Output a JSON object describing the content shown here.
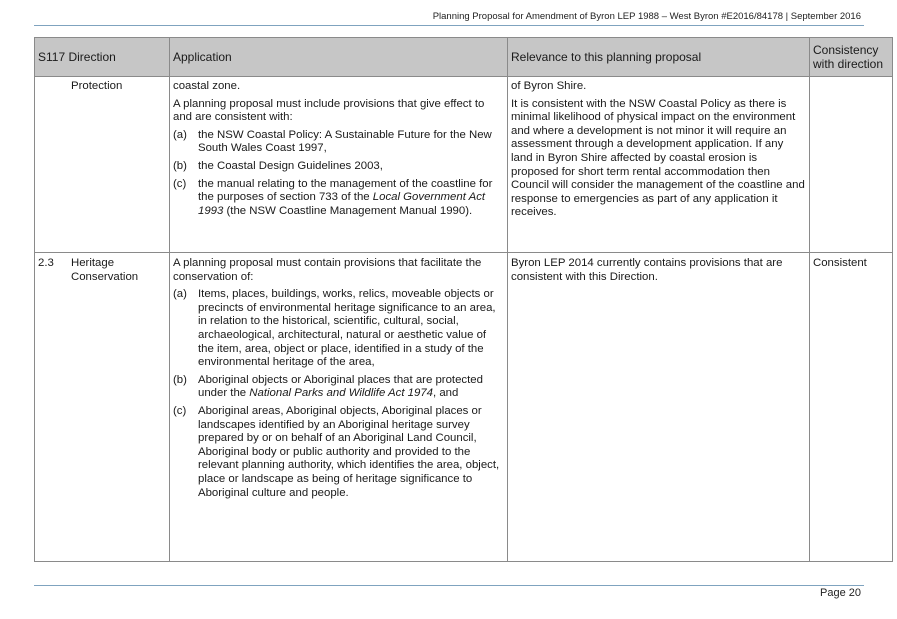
{
  "header": {
    "text": "Planning Proposal for Amendment of Byron LEP 1988 – West Byron #E2016/84178 | September 2016"
  },
  "table": {
    "columns": {
      "direction": "S117 Direction",
      "application": "Application",
      "relevance": "Relevance to this planning proposal",
      "consistency": "Consistency with direction"
    },
    "row1": {
      "number": "",
      "title": "Protection",
      "app_intro": "coastal zone.",
      "app_para": "A planning proposal must include provisions that give effect to and are consistent with:",
      "items": [
        {
          "label": "(a)",
          "text": "the NSW Coastal Policy: A Sustainable Future for the New South Wales Coast 1997,"
        },
        {
          "label": "(b)",
          "text": "the Coastal Design Guidelines 2003,"
        },
        {
          "label": "(c)",
          "pre": "the manual relating to the management of the coastline for the purposes of section 733 of the ",
          "italic": "Local Government Act 1993",
          "post": " (the NSW Coastline Management Manual 1990)."
        }
      ],
      "relevance_1": "of Byron Shire.",
      "relevance_2": "It is consistent with the NSW Coastal Policy as there is minimal likelihood of physical impact on the environment and where a development is not minor it will require an assessment through a development application.  If any land in Byron Shire affected by coastal erosion is proposed for short term rental accommodation then Council will consider the management of the coastline and response to emergencies as part of any application it receives.",
      "consistency": ""
    },
    "row2": {
      "number": "2.3",
      "title": "Heritage Conservation",
      "app_para": "A planning proposal must contain provisions that facilitate the conservation of:",
      "items": [
        {
          "label": "(a)",
          "text": "Items, places, buildings, works, relics, moveable objects or precincts of environmental heritage significance to an area, in relation to the historical, scientific, cultural, social, archaeological, architectural, natural or aesthetic value of the item, area, object or place, identified in a study of the environmental heritage of the area,"
        },
        {
          "label": "(b)",
          "pre": "Aboriginal objects or Aboriginal places that are protected under the ",
          "italic": "National Parks and Wildlife Act 1974",
          "post": ", and"
        },
        {
          "label": "(c)",
          "text": "Aboriginal areas, Aboriginal objects, Aboriginal places or landscapes identified by an Aboriginal heritage survey prepared by or on behalf of an Aboriginal Land Council, Aboriginal body or public authority and provided to the relevant planning authority, which identifies the area, object, place or landscape as being of heritage significance to Aboriginal culture and people."
        }
      ],
      "relevance": "Byron LEP 2014 currently contains provisions that are consistent with this Direction.",
      "consistency": "Consistent"
    }
  },
  "footer": {
    "page": "Page 20"
  }
}
